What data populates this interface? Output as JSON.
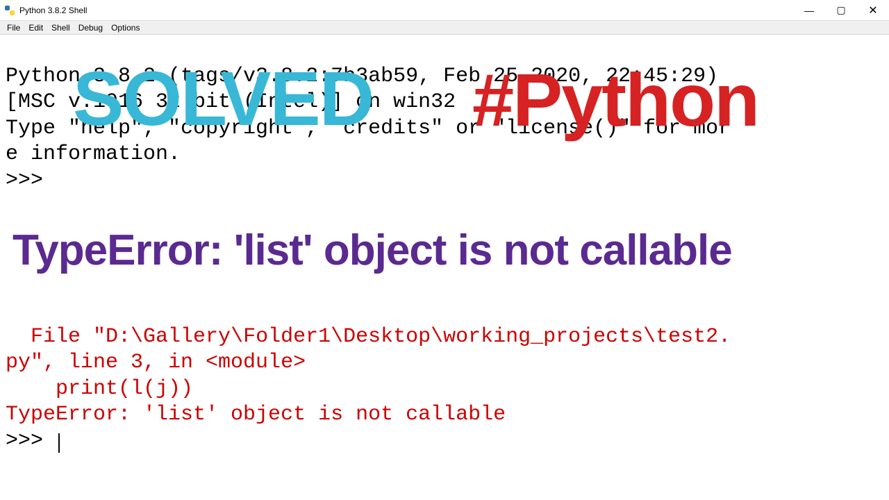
{
  "window": {
    "title": "Python 3.8.2 Shell",
    "minimize": "—",
    "maximize": "▢",
    "close": "✕"
  },
  "menu": {
    "file": "File",
    "edit": "Edit",
    "shell": "Shell",
    "debug": "Debug",
    "options": "Options"
  },
  "shell": {
    "line1": "Python 3.8.2 (tags/v3.8.2:7b3ab59, Feb 25 2020, 22:45:29)",
    "line2": "[MSC v.1916 32 bit (Intel)] on win32",
    "line3a": "Type \"help\", \"copyright\", \"credits\" or \"license()\" for mor",
    "line3b": "e information.",
    "prompt1": ">>> ",
    "blank": " ",
    "traceback1": "  File \"D:\\Gallery\\Folder1\\Desktop\\working_projects\\test2.",
    "traceback2": "py\", line 3, in <module>",
    "traceback3": "    print(l(j))",
    "traceback4": "TypeError: 'list' object is not callable",
    "prompt2": ">>> "
  },
  "overlay": {
    "solved": "SOLVED",
    "hashtag": "#Python",
    "headline": "TypeError: 'list' object is not callable"
  }
}
